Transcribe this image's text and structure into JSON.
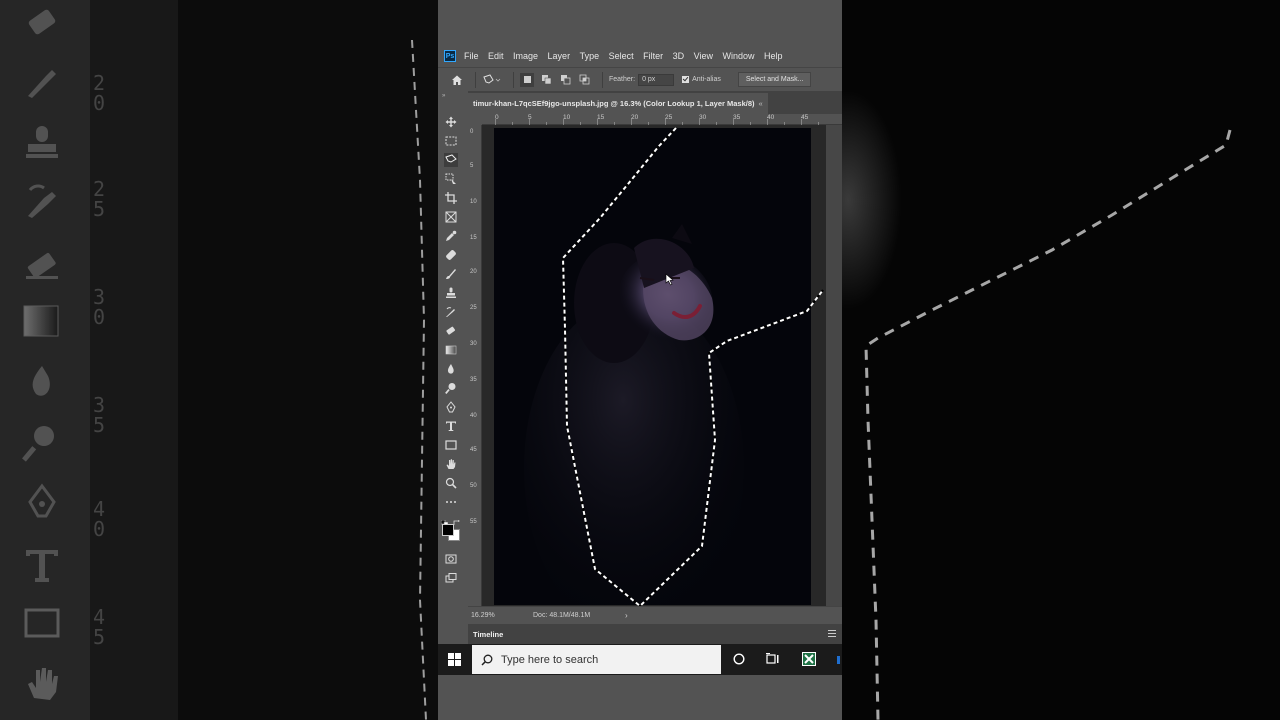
{
  "menubar": {
    "logo": "Ps",
    "items": [
      "File",
      "Edit",
      "Image",
      "Layer",
      "Type",
      "Select",
      "Filter",
      "3D",
      "View",
      "Window",
      "Help"
    ]
  },
  "options": {
    "feather_label": "Feather:",
    "feather_value": "0 px",
    "antialias_label": "Anti-alias",
    "antialias_checked": true,
    "select_mask_label": "Select and Mask..."
  },
  "document": {
    "tab_title": "timur-khan-L7qcSEf9jgo-unsplash.jpg @ 16.3% (Color Lookup 1, Layer Mask/8)",
    "tab_close": "«"
  },
  "rulers": {
    "top": [
      "0",
      "5",
      "10",
      "15",
      "20",
      "25",
      "30",
      "35",
      "40",
      "45"
    ],
    "left": [
      "0",
      "5",
      "10",
      "15",
      "20",
      "25",
      "30",
      "35",
      "40",
      "45",
      "50",
      "55"
    ]
  },
  "status": {
    "zoom": "16.29%",
    "doc_size": "Doc: 48.1M/48.1M",
    "arrow": "›"
  },
  "timeline": {
    "title": "Timeline"
  },
  "taskbar": {
    "search_placeholder": "Type here to search"
  },
  "background_ruler": [
    "2",
    "0",
    "2",
    "5",
    "3",
    "0",
    "3",
    "5",
    "4",
    "0",
    "4",
    "5"
  ],
  "colors": {
    "ps_panel": "#535353",
    "ps_dark": "#424242",
    "photoshop_blue": "#31a8ff",
    "taskbar": "#1b1b1b",
    "excel_green": "#1e7145"
  }
}
